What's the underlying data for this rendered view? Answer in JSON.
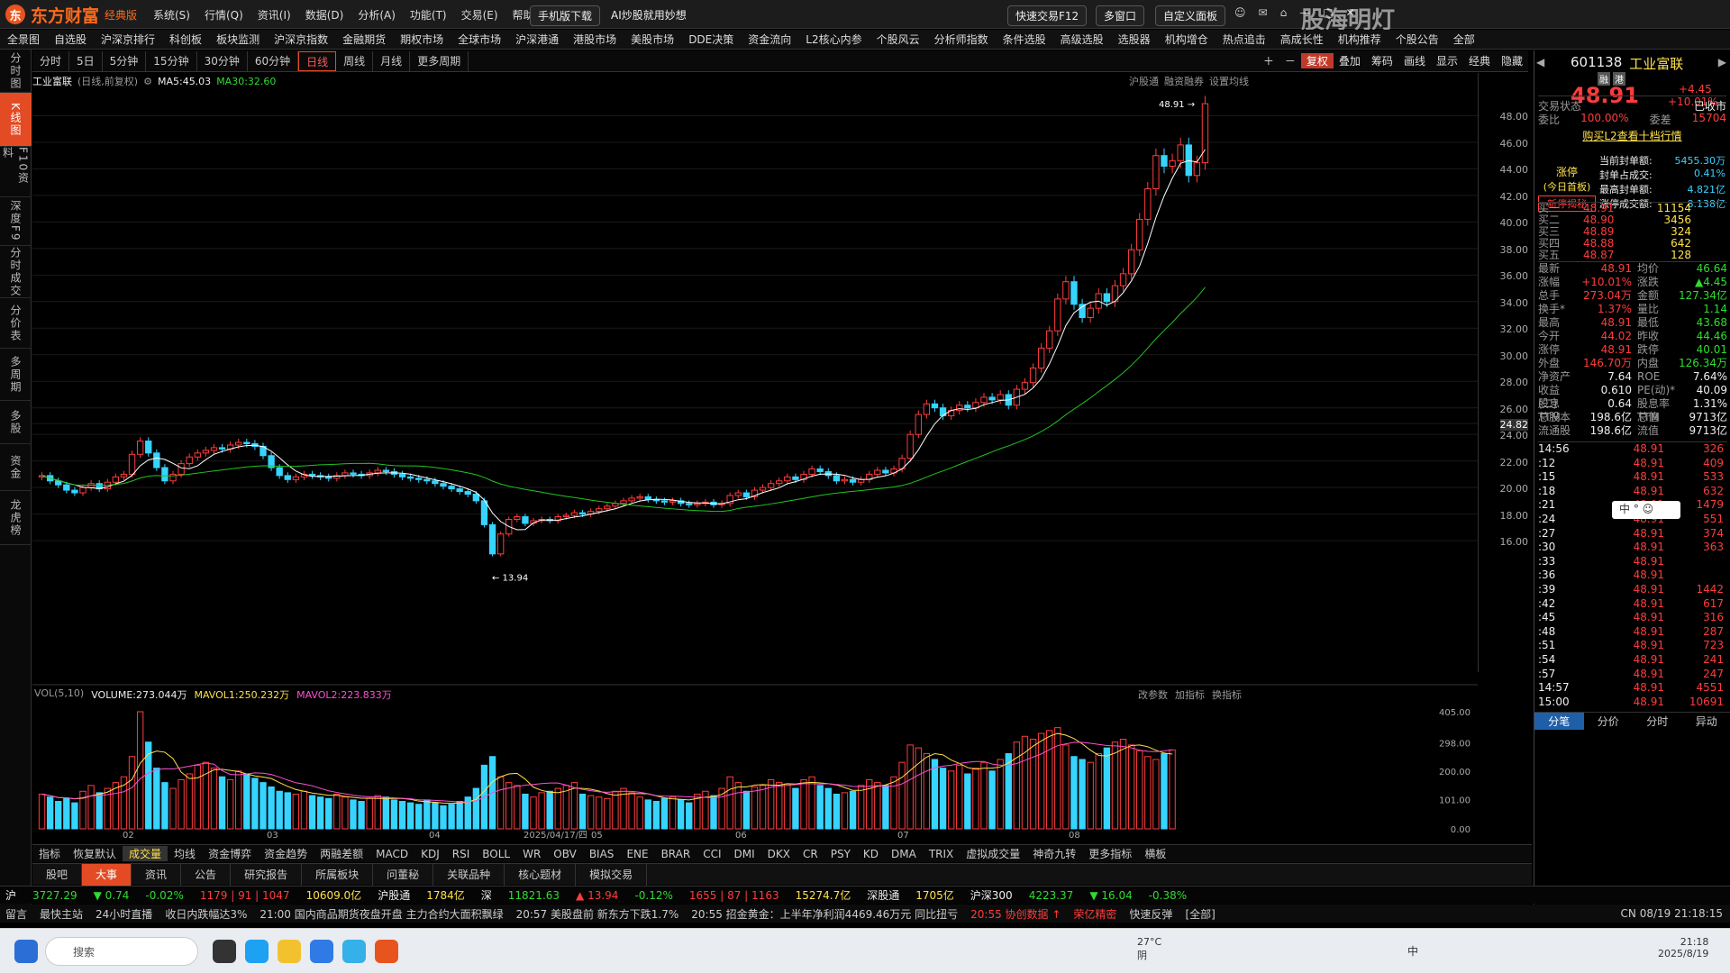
{
  "app": {
    "brand": "东方财富",
    "edition": "经典版",
    "menus": [
      "系统(S)",
      "行情(Q)",
      "资讯(I)",
      "数据(D)",
      "分析(A)",
      "功能(T)",
      "交易(E)",
      "帮助(H)"
    ],
    "mobile_btn": "手机版下载",
    "ai_btn": "AI炒股就用妙想",
    "quick_trade": "快速交易F12",
    "multi_window": "多窗口",
    "custom_panel": "自定义面板",
    "watermark": "股海明灯"
  },
  "nav": [
    "全景图",
    "自选股",
    "沪深京排行",
    "科创板",
    "板块监测",
    "沪深京指数",
    "金融期货",
    "期权市场",
    "全球市场",
    "沪深港通",
    "港股市场",
    "美股市场",
    "DDE决策",
    "资金流向",
    "L2核心内参",
    "个股风云",
    "分析师指数",
    "条件选股",
    "高级选股",
    "选股器",
    "机构增仓",
    "热点追击",
    "高成长性",
    "机构推荐",
    "个股公告",
    "全部"
  ],
  "left_strip": [
    "分时图",
    "K线图",
    "F10资料",
    "深度F9",
    "分时成交",
    "分价表",
    "多周期",
    "多股",
    "资金",
    "龙虎榜"
  ],
  "periods": [
    "分时",
    "5日",
    "5分钟",
    "15分钟",
    "30分钟",
    "60分钟",
    "日线",
    "周线",
    "月线",
    "更多周期"
  ],
  "active_period": "日线",
  "period_tools": [
    "复权",
    "叠加",
    "筹码",
    "画线",
    "显示",
    "经典",
    "隐藏"
  ],
  "chart_header": {
    "name": "工业富联",
    "mode": "(日线,前复权)",
    "ma5": "MA5:45.03",
    "ma30": "MA30:32.60",
    "links": [
      "沪股通",
      "融资融券",
      "设置均线"
    ]
  },
  "vol_header": {
    "title": "VOL(5,10)",
    "volume": "VOLUME:273.044万",
    "mavol1": "MAVOL1:250.232万",
    "mavol2": "MAVOL2:223.833万",
    "tools": [
      "改参数",
      "加指标",
      "换指标"
    ]
  },
  "price_axis": [
    "48.00",
    "46.00",
    "44.00",
    "42.00",
    "40.00",
    "38.00",
    "36.00",
    "34.00",
    "32.00",
    "30.00",
    "28.00",
    "26.00",
    "24.82",
    "24.00",
    "22.00",
    "20.00",
    "18.00",
    "16.00"
  ],
  "vol_axis": [
    "405.00",
    "298.00",
    "200.00",
    "101.00",
    "0.00"
  ],
  "x_axis": [
    "02",
    "03",
    "04",
    "2025/04/17/四",
    "05",
    "06",
    "07",
    "08"
  ],
  "annotations": {
    "high": "48.91",
    "low": "13.94"
  },
  "chart_data": {
    "type": "candlestick",
    "title": "工业富联",
    "ylim": [
      13,
      50
    ],
    "note_high": 48.91,
    "note_low": 13.94,
    "closes": [
      20.9,
      20.5,
      20.2,
      19.8,
      19.6,
      20.0,
      20.3,
      19.9,
      20.4,
      20.8,
      21.0,
      22.5,
      23.5,
      22.6,
      21.5,
      20.5,
      21.0,
      21.8,
      22.3,
      22.6,
      22.8,
      23.0,
      22.9,
      23.2,
      23.4,
      23.3,
      23.1,
      22.4,
      21.5,
      20.9,
      20.6,
      20.8,
      21.0,
      20.9,
      20.8,
      20.7,
      20.9,
      21.1,
      21.0,
      20.9,
      21.1,
      21.3,
      21.2,
      21.0,
      20.8,
      20.7,
      20.6,
      20.5,
      20.3,
      20.1,
      19.9,
      19.7,
      19.5,
      19.0,
      17.2,
      15.0,
      16.5,
      17.6,
      17.8,
      17.3,
      17.5,
      17.6,
      17.5,
      17.8,
      17.9,
      18.1,
      18.0,
      18.2,
      18.4,
      18.6,
      18.8,
      19.0,
      19.2,
      19.3,
      19.1,
      19.0,
      18.9,
      19.0,
      18.8,
      18.7,
      18.8,
      18.9,
      18.7,
      18.8,
      19.4,
      19.6,
      19.3,
      19.8,
      20.0,
      20.3,
      20.5,
      20.8,
      20.6,
      21.0,
      21.4,
      21.2,
      20.9,
      20.5,
      20.6,
      20.4,
      20.6,
      21.0,
      21.3,
      21.1,
      21.4,
      22.2,
      24.0,
      25.5,
      26.3,
      26.0,
      25.4,
      25.8,
      26.2,
      26.0,
      26.4,
      26.8,
      26.6,
      27.0,
      26.2,
      27.4,
      27.9,
      29.0,
      30.5,
      31.8,
      34.2,
      35.5,
      33.8,
      32.8,
      33.5,
      34.6,
      34.0,
      35.2,
      36.1,
      37.9,
      40.2,
      42.5,
      45.0,
      44.2,
      44.6,
      45.8,
      43.5,
      44.46,
      48.91
    ],
    "volumes": [
      120,
      110,
      95,
      105,
      90,
      130,
      150,
      125,
      140,
      160,
      180,
      250,
      405,
      300,
      210,
      160,
      140,
      170,
      190,
      220,
      230,
      210,
      180,
      170,
      200,
      190,
      175,
      160,
      145,
      130,
      125,
      120,
      130,
      115,
      110,
      105,
      120,
      110,
      100,
      95,
      105,
      115,
      110,
      100,
      95,
      90,
      85,
      100,
      90,
      80,
      85,
      95,
      110,
      140,
      220,
      250,
      180,
      160,
      150,
      120,
      110,
      125,
      130,
      140,
      150,
      160,
      120,
      115,
      110,
      105,
      130,
      140,
      125,
      110,
      100,
      95,
      105,
      110,
      100,
      90,
      120,
      130,
      115,
      140,
      180,
      160,
      130,
      145,
      150,
      170,
      160,
      155,
      140,
      170,
      180,
      150,
      140,
      120,
      125,
      130,
      150,
      170,
      160,
      150,
      180,
      230,
      290,
      280,
      260,
      240,
      210,
      200,
      220,
      190,
      210,
      230,
      200,
      240,
      260,
      300,
      320,
      310,
      330,
      340,
      350,
      290,
      250,
      240,
      230,
      260,
      280,
      300,
      310,
      290,
      270,
      250,
      240,
      260,
      273
    ]
  },
  "right": {
    "code": "601138",
    "name": "工业富联",
    "tags": [
      "融",
      "港"
    ],
    "price": "48.91",
    "change": "+4.45",
    "pct": "+10.01%",
    "trade_status_label": "交易状态",
    "trade_status": "已收市",
    "weibi_label": "委比",
    "weibi": "100.00%",
    "weicha_label": "委差",
    "weicha": "15704",
    "l2_link": "购买L2查看十档行情",
    "limit_title": "涨停",
    "limit_sub": "(今日首板)",
    "limit_tag": "新停揭秘",
    "limit_rows": [
      [
        "当前封单额:",
        "5455.30万"
      ],
      [
        "封单占成交:",
        "0.41%"
      ],
      [
        "最高封单额:",
        "4.821亿"
      ],
      [
        "涨停成交额:",
        "8.138亿"
      ]
    ],
    "bids": [
      [
        "买一",
        "48.91",
        "11154"
      ],
      [
        "买二",
        "48.90",
        "3456"
      ],
      [
        "买三",
        "48.89",
        "324"
      ],
      [
        "买四",
        "48.88",
        "642"
      ],
      [
        "买五",
        "48.87",
        "128"
      ]
    ],
    "quote": [
      [
        "最新",
        "48.91",
        "均价",
        "46.64"
      ],
      [
        "涨幅",
        "+10.01%",
        "涨跌",
        "▲4.45"
      ],
      [
        "总手",
        "273.04万",
        "金额",
        "127.34亿"
      ],
      [
        "换手*",
        "1.37%",
        "量比",
        "1.14"
      ],
      [
        "最高",
        "48.91",
        "最低",
        "43.68"
      ],
      [
        "今开",
        "44.02",
        "昨收",
        "44.46"
      ],
      [
        "涨停",
        "48.91",
        "跌停",
        "40.01"
      ],
      [
        "外盘",
        "146.70万",
        "内盘",
        "126.34万"
      ],
      [
        "净资产",
        "7.64",
        "ROE",
        "7.64%"
      ],
      [
        "收益(二)",
        "0.610",
        "PE(动)*",
        "40.09"
      ],
      [
        "股息TTM",
        "0.64",
        "股息率TTM",
        "1.31%"
      ],
      [
        "总股本",
        "198.6亿",
        "总值",
        "9713亿"
      ],
      [
        "流通股",
        "198.6亿",
        "流值",
        "9713亿"
      ]
    ],
    "ticks": [
      [
        "14:56",
        "48.91",
        "326"
      ],
      [
        ":12",
        "48.91",
        "409"
      ],
      [
        ":15",
        "48.91",
        "533"
      ],
      [
        ":18",
        "48.91",
        "632"
      ],
      [
        ":21",
        "48.91",
        "1479"
      ],
      [
        ":24",
        "48.91",
        "551"
      ],
      [
        ":27",
        "48.91",
        "374"
      ],
      [
        ":30",
        "48.91",
        "363"
      ],
      [
        ":33",
        "48.91",
        ""
      ],
      [
        ":36",
        "48.91",
        ""
      ],
      [
        ":39",
        "48.91",
        "1442"
      ],
      [
        ":42",
        "48.91",
        "617"
      ],
      [
        ":45",
        "48.91",
        "316"
      ],
      [
        ":48",
        "48.91",
        "287"
      ],
      [
        ":51",
        "48.91",
        "723"
      ],
      [
        ":54",
        "48.91",
        "241"
      ],
      [
        ":57",
        "48.91",
        "247"
      ],
      [
        "14:57",
        "48.91",
        "4551"
      ],
      [
        "15:00",
        "48.91",
        "10691"
      ]
    ],
    "bottom_tabs": [
      "分笔",
      "分价",
      "分时",
      "异动"
    ],
    "ime": "中"
  },
  "indicators": [
    "指标",
    "恢复默认",
    "成交量",
    "均线",
    "资金博弈",
    "资金趋势",
    "两融差额",
    "MACD",
    "KDJ",
    "RSI",
    "BOLL",
    "WR",
    "OBV",
    "BIAS",
    "ENE",
    "BRAR",
    "CCI",
    "DMI",
    "DKX",
    "CR",
    "PSY",
    "KD",
    "DMA",
    "TRIX",
    "虚拟成交量",
    "神奇九转",
    "更多指标",
    "横板"
  ],
  "news_tabs": [
    "股吧",
    "大事",
    "资讯",
    "公告",
    "研究报告",
    "所属板块",
    "问董秘",
    "关联品种",
    "核心题材",
    "模拟交易"
  ],
  "ticker": {
    "sh_label": "沪",
    "sh": "3727.29",
    "sh_chg": "▼ 0.74",
    "sh_pct": "-0.02%",
    "sh_counts": "1179 | 91 | 1047",
    "sh_amt": "10609.0亿",
    "hgt_label": "沪股通",
    "hgt": "1784亿",
    "sz_label": "深",
    "sz": "11821.63",
    "sz_chg": "▲ 13.94",
    "sz_pct": "-0.12%",
    "sz_counts": "1655 | 87 | 1163",
    "sz_amt": "15274.7亿",
    "sgt_label": "深股通",
    "sgt": "1705亿",
    "hs300_label": "沪深300",
    "hs300": "4223.37",
    "hs300_chg": "▼ 16.04",
    "hs300_pct": "-0.38%"
  },
  "news_line": [
    "留言",
    "最快主站",
    "24小时直播",
    "收日内跌幅达3%",
    "21:00 国内商品期货夜盘开盘 主力合约大面积飘绿",
    "20:57 美股盘前 新东方下跌1.7%",
    "20:55 招金黄金：上半年净利润4469.46万元 同比扭亏",
    "20:55 协创数据 ↑",
    "荣亿精密",
    "快速反弹",
    "[全部]"
  ],
  "taskbar": {
    "search": "搜索",
    "weather": "27°C",
    "weather_sub": "阴",
    "lang": "中",
    "time": "21:18",
    "date": "2025/8/19",
    "status": "CN 08/19 21:18:15"
  }
}
